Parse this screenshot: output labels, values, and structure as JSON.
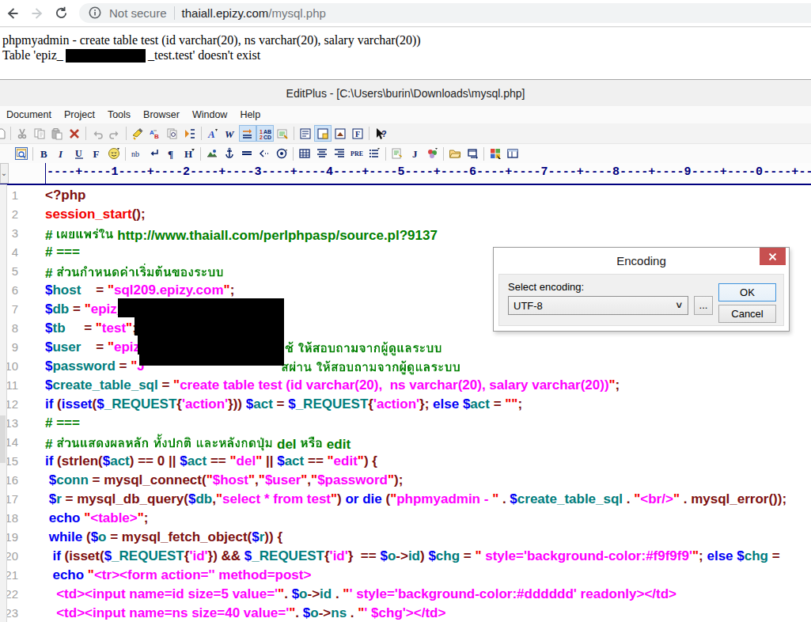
{
  "browser": {
    "security_label": "Not secure",
    "url_domain": "thaiall.epizy.com",
    "url_path": "/mysql.php"
  },
  "page": {
    "line1": "phpmyadmin - create table test (id varchar(20), ns varchar(20), salary varchar(20))",
    "line2_prefix": "Table 'epiz_",
    "line2_suffix": "_test.test' doesn't exist"
  },
  "editor": {
    "title": "EditPlus - [C:\\Users\\burin\\Downloads\\mysql.php]",
    "menus": [
      "Document",
      "Project",
      "Tools",
      "Browser",
      "Window",
      "Help"
    ],
    "toolbar_main": [
      "doc-partial",
      "|",
      "cut",
      "copy",
      "paste",
      "delete",
      "|",
      "undo",
      "redo",
      "|",
      "find",
      "replace-ab",
      "find-files",
      "next-marker",
      "|",
      "font-a",
      "wrap-w",
      "spaces!",
      "line-numbers!",
      "syntax-colors",
      "|",
      "cliptext",
      "directory!",
      "ftp",
      "functions-f",
      "|",
      "context-help"
    ],
    "toolbar_html": [
      "browser-preview",
      "|",
      "bold-b",
      "italic-i",
      "underline-u",
      "font-f",
      "special-char",
      "|",
      "nbsp",
      "linebreak",
      "paragraph",
      "heading-h",
      "|",
      "image",
      "anchor",
      "hrule",
      "comment",
      "object",
      "|",
      "table",
      "align-center",
      "align-right",
      "pre",
      "list",
      "|",
      "script",
      "applet-j",
      "colors",
      "|",
      "folder-open",
      "window-swap",
      "|",
      "win-colors",
      "frame-window"
    ],
    "ruler": "----+----1----+----2----+----3----+----4----+----5----+----6----+----7----+----8----+----9----+----0----+---"
  },
  "dialog": {
    "title": "Encoding",
    "label": "Select encoding:",
    "combo_value": "UTF-8",
    "browse_label": "...",
    "ok_label": "OK",
    "cancel_label": "Cancel"
  },
  "colors": {
    "syntax_keyword": "#0000f5",
    "syntax_variable": "#007d7d",
    "syntax_string_quote": "#f40000",
    "syntax_string_body": "#ff00ff",
    "syntax_comment": "#008000",
    "syntax_operator": "#7d1010",
    "ruler_navy": "#00007f",
    "dialog_close_red": "#c75050",
    "toolbar_highlight": "#cfe3f7"
  },
  "code": {
    "lines": [
      {
        "n": 1,
        "segs": [
          [
            "m",
            "<?php"
          ]
        ]
      },
      {
        "n": 2,
        "segs": [
          [
            "r",
            "session_start"
          ],
          [
            "m",
            "();"
          ]
        ]
      },
      {
        "n": 3,
        "segs": [
          [
            "g",
            "# "
          ],
          [
            "g",
            "เผยแพร่ใน",
            "thai_l3"
          ],
          [
            "g",
            " http://www.thaiall.com/perlphpasp/source.pl?9137"
          ]
        ]
      },
      {
        "n": 4,
        "segs": [
          [
            "g",
            "# ==="
          ]
        ]
      },
      {
        "n": 5,
        "segs": [
          [
            "g",
            "# "
          ],
          [
            "g",
            "ส่วนกำหนดค่าเริ่มต้นของระบบ",
            "thai_l5"
          ]
        ]
      },
      {
        "n": 6,
        "segs": [
          [
            "b",
            "$"
          ],
          [
            "t",
            "host"
          ],
          [
            "k",
            "    "
          ],
          [
            "m",
            "= "
          ],
          [
            "r",
            "\""
          ],
          [
            "p",
            "sql209.epizy.com"
          ],
          [
            "r",
            "\""
          ],
          [
            "m",
            ";"
          ]
        ]
      },
      {
        "n": 7,
        "segs": [
          [
            "b",
            "$"
          ],
          [
            "t",
            "db"
          ],
          [
            "k",
            " "
          ],
          [
            "m",
            "= "
          ],
          [
            "r",
            "\""
          ],
          [
            "p",
            "epiz_"
          ]
        ]
      },
      {
        "n": 8,
        "segs": [
          [
            "b",
            "$"
          ],
          [
            "t",
            "tb"
          ],
          [
            "k",
            "     "
          ],
          [
            "m",
            "= "
          ],
          [
            "r",
            "\""
          ],
          [
            "p",
            "test"
          ],
          [
            "r",
            "\""
          ],
          [
            "m",
            ";"
          ]
        ]
      },
      {
        "n": 9,
        "segs": [
          [
            "b",
            "$"
          ],
          [
            "t",
            "user"
          ],
          [
            "k",
            "    "
          ],
          [
            "m",
            "= "
          ],
          [
            "r",
            "\""
          ],
          [
            "p",
            "epiz"
          ],
          [
            "g",
            "ช้ ให้สอบถามจากผู้ดูแลระบบ",
            "thai_l9",
            360
          ]
        ]
      },
      {
        "n": 10,
        "segs": [
          [
            "b",
            "$"
          ],
          [
            "t",
            "password"
          ],
          [
            "k",
            " "
          ],
          [
            "m",
            "= "
          ],
          [
            "r",
            "\""
          ],
          [
            "p",
            "J"
          ],
          [
            "g",
            "สผ่าน ให้สอบถามจากผู้ดูแลระบบ",
            "thai_l10",
            355
          ]
        ]
      },
      {
        "n": 11,
        "segs": [
          [
            "b",
            "$"
          ],
          [
            "t",
            "create_table_sql"
          ],
          [
            "m",
            " = "
          ],
          [
            "r",
            "\""
          ],
          [
            "p",
            "create table test (id varchar(20),  ns varchar(20), salary varchar(20))"
          ],
          [
            "r",
            "\""
          ],
          [
            "m",
            ";"
          ]
        ]
      },
      {
        "n": 12,
        "segs": [
          [
            "b",
            "if "
          ],
          [
            "m",
            "("
          ],
          [
            "b",
            "isset"
          ],
          [
            "m",
            "("
          ],
          [
            "b",
            "$"
          ],
          [
            "t",
            "_REQUEST"
          ],
          [
            "m",
            "{"
          ],
          [
            "p",
            "'action'"
          ],
          [
            "m",
            "})) "
          ],
          [
            "b",
            "$"
          ],
          [
            "t",
            "act"
          ],
          [
            "m",
            " = "
          ],
          [
            "b",
            "$"
          ],
          [
            "t",
            "_REQUEST"
          ],
          [
            "m",
            "{"
          ],
          [
            "p",
            "'action'"
          ],
          [
            "m",
            "}; "
          ],
          [
            "b",
            "else "
          ],
          [
            "b",
            "$"
          ],
          [
            "t",
            "act"
          ],
          [
            "m",
            " = "
          ],
          [
            "r",
            "\"\""
          ],
          [
            "m",
            ";"
          ]
        ]
      },
      {
        "n": 13,
        "segs": [
          [
            "g",
            "# ==="
          ]
        ]
      },
      {
        "n": 14,
        "segs": [
          [
            "g",
            "# "
          ],
          [
            "g",
            "ส่วนแสดงผลหลัก ทั้งปกติ และหลังกดปุ่ม",
            "thai_l14a"
          ],
          [
            "g",
            " del "
          ],
          [
            "g",
            "หรือ",
            "thai_l14b"
          ],
          [
            "g",
            " edit"
          ]
        ]
      },
      {
        "n": 15,
        "segs": [
          [
            "b",
            "if "
          ],
          [
            "m",
            "(strlen("
          ],
          [
            "b",
            "$"
          ],
          [
            "t",
            "act"
          ],
          [
            "m",
            ") == 0 || "
          ],
          [
            "b",
            "$"
          ],
          [
            "t",
            "act"
          ],
          [
            "m",
            " == "
          ],
          [
            "r",
            "\""
          ],
          [
            "p",
            "del"
          ],
          [
            "r",
            "\""
          ],
          [
            "m",
            " || "
          ],
          [
            "b",
            "$"
          ],
          [
            "t",
            "act"
          ],
          [
            "m",
            " == "
          ],
          [
            "r",
            "\""
          ],
          [
            "p",
            "edit"
          ],
          [
            "r",
            "\""
          ],
          [
            "m",
            ") {"
          ]
        ]
      },
      {
        "n": 16,
        "segs": [
          [
            "k",
            " "
          ],
          [
            "b",
            "$"
          ],
          [
            "t",
            "conn"
          ],
          [
            "m",
            " = mysql_connect("
          ],
          [
            "r",
            "\""
          ],
          [
            "p",
            "$host"
          ],
          [
            "r",
            "\""
          ],
          [
            "m",
            ","
          ],
          [
            "r",
            "\""
          ],
          [
            "p",
            "$user"
          ],
          [
            "r",
            "\""
          ],
          [
            "m",
            ","
          ],
          [
            "r",
            "\""
          ],
          [
            "p",
            "$password"
          ],
          [
            "r",
            "\""
          ],
          [
            "m",
            ");"
          ]
        ]
      },
      {
        "n": 17,
        "segs": [
          [
            "k",
            " "
          ],
          [
            "b",
            "$"
          ],
          [
            "t",
            "r"
          ],
          [
            "m",
            " = mysql_db_query("
          ],
          [
            "b",
            "$"
          ],
          [
            "t",
            "db"
          ],
          [
            "m",
            ","
          ],
          [
            "r",
            "\""
          ],
          [
            "p",
            "select * from test"
          ],
          [
            "r",
            "\""
          ],
          [
            "m",
            ") "
          ],
          [
            "b",
            "or die "
          ],
          [
            "m",
            "("
          ],
          [
            "r",
            "\""
          ],
          [
            "p",
            "phpmyadmin - "
          ],
          [
            "r",
            "\""
          ],
          [
            "m",
            " . "
          ],
          [
            "b",
            "$"
          ],
          [
            "t",
            "create_table_sql"
          ],
          [
            "m",
            " . "
          ],
          [
            "r",
            "\""
          ],
          [
            "p",
            "<br/>"
          ],
          [
            "r",
            "\""
          ],
          [
            "m",
            " . mysql_error());"
          ]
        ]
      },
      {
        "n": 18,
        "segs": [
          [
            "k",
            " "
          ],
          [
            "b",
            "echo "
          ],
          [
            "r",
            "\""
          ],
          [
            "p",
            "<table>"
          ],
          [
            "r",
            "\""
          ],
          [
            "m",
            ";"
          ]
        ]
      },
      {
        "n": 19,
        "segs": [
          [
            "k",
            " "
          ],
          [
            "b",
            "while "
          ],
          [
            "m",
            "("
          ],
          [
            "b",
            "$"
          ],
          [
            "t",
            "o"
          ],
          [
            "m",
            " = mysql_fetch_object("
          ],
          [
            "b",
            "$"
          ],
          [
            "t",
            "r"
          ],
          [
            "m",
            ")) {"
          ]
        ]
      },
      {
        "n": 20,
        "segs": [
          [
            "k",
            "  "
          ],
          [
            "b",
            "if "
          ],
          [
            "m",
            "(isset("
          ],
          [
            "b",
            "$"
          ],
          [
            "t",
            "_REQUEST"
          ],
          [
            "m",
            "{"
          ],
          [
            "p",
            "'id'"
          ],
          [
            "m",
            "}) && "
          ],
          [
            "b",
            "$"
          ],
          [
            "t",
            "_REQUEST"
          ],
          [
            "m",
            "{"
          ],
          [
            "p",
            "'id'"
          ],
          [
            "m",
            "}  == "
          ],
          [
            "b",
            "$"
          ],
          [
            "t",
            "o"
          ],
          [
            "m",
            "->"
          ],
          [
            "t",
            "id"
          ],
          [
            "m",
            ") "
          ],
          [
            "b",
            "$"
          ],
          [
            "t",
            "chg"
          ],
          [
            "m",
            " = "
          ],
          [
            "r",
            "\""
          ],
          [
            "p",
            " style='background-color:#f9f9f9'"
          ],
          [
            "r",
            "\""
          ],
          [
            "m",
            "; "
          ],
          [
            "b",
            "else "
          ],
          [
            "b",
            "$"
          ],
          [
            "t",
            "chg"
          ],
          [
            "m",
            " ="
          ]
        ]
      },
      {
        "n": 21,
        "segs": [
          [
            "k",
            "  "
          ],
          [
            "b",
            "echo "
          ],
          [
            "r",
            "\""
          ],
          [
            "p",
            "<tr><form action='' method=post>"
          ]
        ]
      },
      {
        "n": 22,
        "segs": [
          [
            "k",
            "   "
          ],
          [
            "p",
            "<td><input name=id size=5 value='"
          ],
          [
            "r",
            "\""
          ],
          [
            "m",
            ". "
          ],
          [
            "b",
            "$"
          ],
          [
            "t",
            "o"
          ],
          [
            "m",
            "->"
          ],
          [
            "t",
            "id"
          ],
          [
            "m",
            " . "
          ],
          [
            "r",
            "\""
          ],
          [
            "p",
            "' style='background-color:#dddddd' readonly></td>"
          ]
        ]
      },
      {
        "n": 23,
        "segs": [
          [
            "k",
            "   "
          ],
          [
            "p",
            "<td><input name=ns size=40 value='"
          ],
          [
            "r",
            "\""
          ],
          [
            "m",
            ". "
          ],
          [
            "b",
            "$"
          ],
          [
            "t",
            "o"
          ],
          [
            "m",
            "->"
          ],
          [
            "t",
            "ns"
          ],
          [
            "m",
            " . "
          ],
          [
            "r",
            "\""
          ],
          [
            "p",
            "' $chg'></td>"
          ]
        ]
      }
    ]
  }
}
